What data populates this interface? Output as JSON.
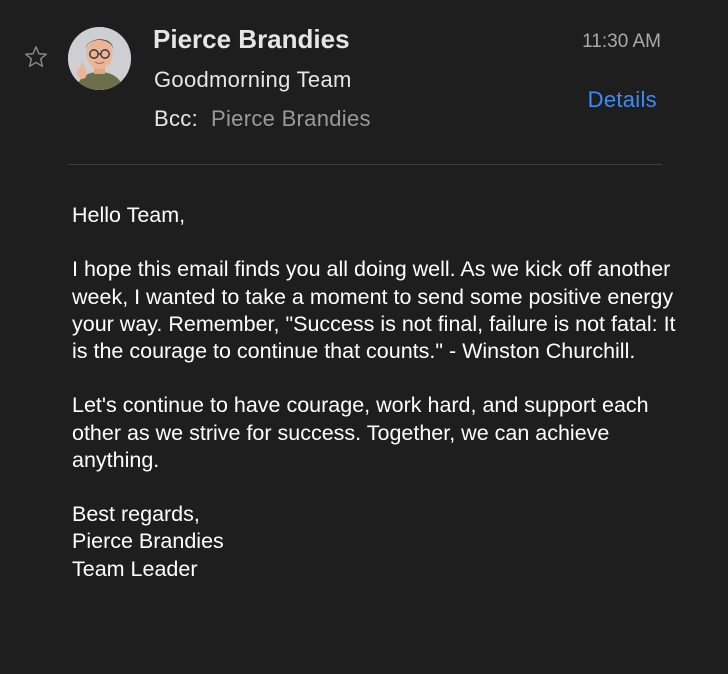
{
  "message": {
    "sender_name": "Pierce Brandies",
    "time": "11:30 AM",
    "subject": "Goodmorning Team",
    "bcc_label": "Bcc:",
    "bcc_value": "Pierce Brandies",
    "details_label": "Details",
    "star_icon": "star-outline-icon",
    "avatar_icon": "memoji-avatar"
  },
  "body": {
    "greeting": "Hello Team,",
    "paragraph1": "I hope this email finds you all doing well. As we kick off another week, I wanted to take a moment to send some positive energy your way. Remember, \"Success is not final, failure is not fatal: It is the courage to continue that counts.\" - Winston Churchill.",
    "paragraph2": "Let's continue to have courage, work hard, and support each other as we strive for success. Together, we can achieve anything.",
    "closing": "Best regards,",
    "signature_name": "Pierce Brandies",
    "signature_title": "Team Leader"
  },
  "colors": {
    "background": "#1e1e1e",
    "text": "#ffffff",
    "muted": "#a9a9ab",
    "accent": "#3d8bf7",
    "divider": "#3c3c3e"
  }
}
